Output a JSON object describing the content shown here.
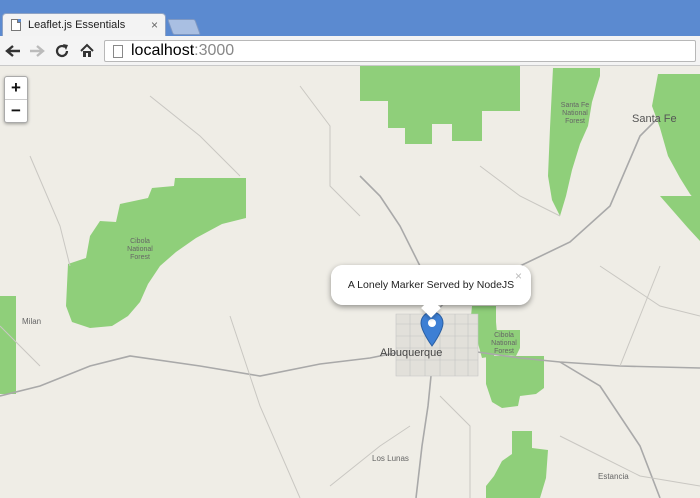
{
  "browser": {
    "tab_title": "Leaflet.js Essentials",
    "tab_close": "×",
    "url_host": "localhost",
    "url_port": ":3000"
  },
  "map": {
    "zoom_in": "+",
    "zoom_out": "−",
    "popup_text": "A Lonely Marker Served by NodeJS",
    "popup_close": "×",
    "place_labels": {
      "albuquerque": "Albuquerque",
      "santa_fe": "Santa Fe",
      "los_lunas": "Los Lunas",
      "milan": "Milan",
      "estancia": "Estancia",
      "cibola": "Cibola National Forest",
      "santa_fe_forest": "Santa Fe National Forest",
      "cibola_east": "Cibola National Forest"
    },
    "colors": {
      "forest": "#8fcf7a",
      "background": "#efede6",
      "road": "#a8a8a8",
      "marker": "#3d7fd4"
    }
  }
}
